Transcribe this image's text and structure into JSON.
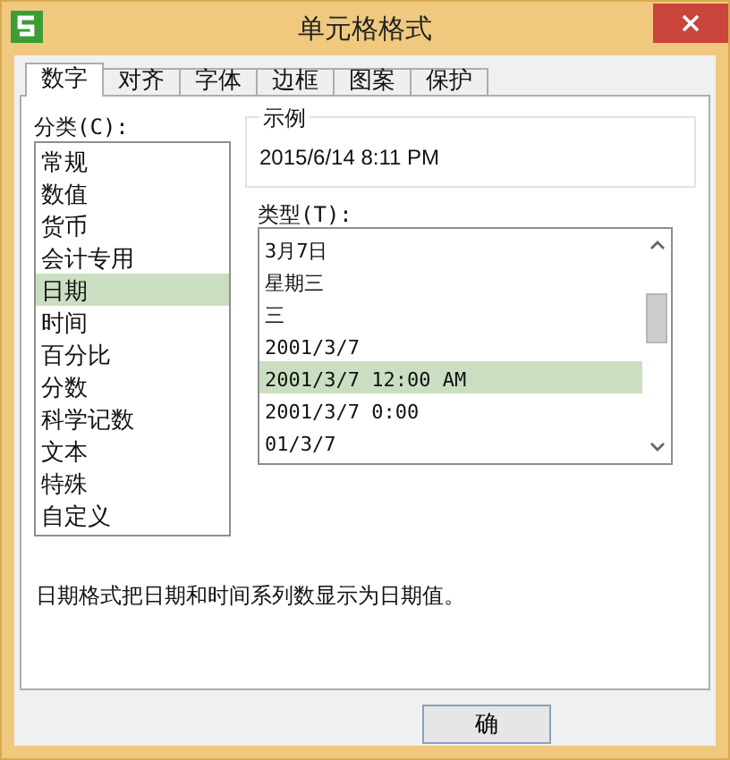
{
  "window": {
    "title": "单元格格式"
  },
  "tabs": [
    {
      "label": "数字",
      "selected": true
    },
    {
      "label": "对齐",
      "selected": false
    },
    {
      "label": "字体",
      "selected": false
    },
    {
      "label": "边框",
      "selected": false
    },
    {
      "label": "图案",
      "selected": false
    },
    {
      "label": "保护",
      "selected": false
    }
  ],
  "category": {
    "label": "分类(C):",
    "items": [
      {
        "label": "常规",
        "selected": false
      },
      {
        "label": "数值",
        "selected": false
      },
      {
        "label": "货币",
        "selected": false
      },
      {
        "label": "会计专用",
        "selected": false
      },
      {
        "label": "日期",
        "selected": true
      },
      {
        "label": "时间",
        "selected": false
      },
      {
        "label": "百分比",
        "selected": false
      },
      {
        "label": "分数",
        "selected": false
      },
      {
        "label": "科学记数",
        "selected": false
      },
      {
        "label": "文本",
        "selected": false
      },
      {
        "label": "特殊",
        "selected": false
      },
      {
        "label": "自定义",
        "selected": false
      }
    ]
  },
  "sample": {
    "label": "示例",
    "value": "2015/6/14 8:11 PM"
  },
  "type": {
    "label": "类型(T):",
    "items": [
      {
        "label": "3月7日",
        "selected": false
      },
      {
        "label": "星期三",
        "selected": false
      },
      {
        "label": "三",
        "selected": false
      },
      {
        "label": "2001/3/7",
        "selected": false
      },
      {
        "label": "2001/3/7 12:00 AM",
        "selected": true
      },
      {
        "label": "2001/3/7 0:00",
        "selected": false
      },
      {
        "label": "01/3/7",
        "selected": false
      }
    ]
  },
  "description": "日期格式把日期和时间系列数显示为日期值。",
  "buttons": [
    "确"
  ]
}
